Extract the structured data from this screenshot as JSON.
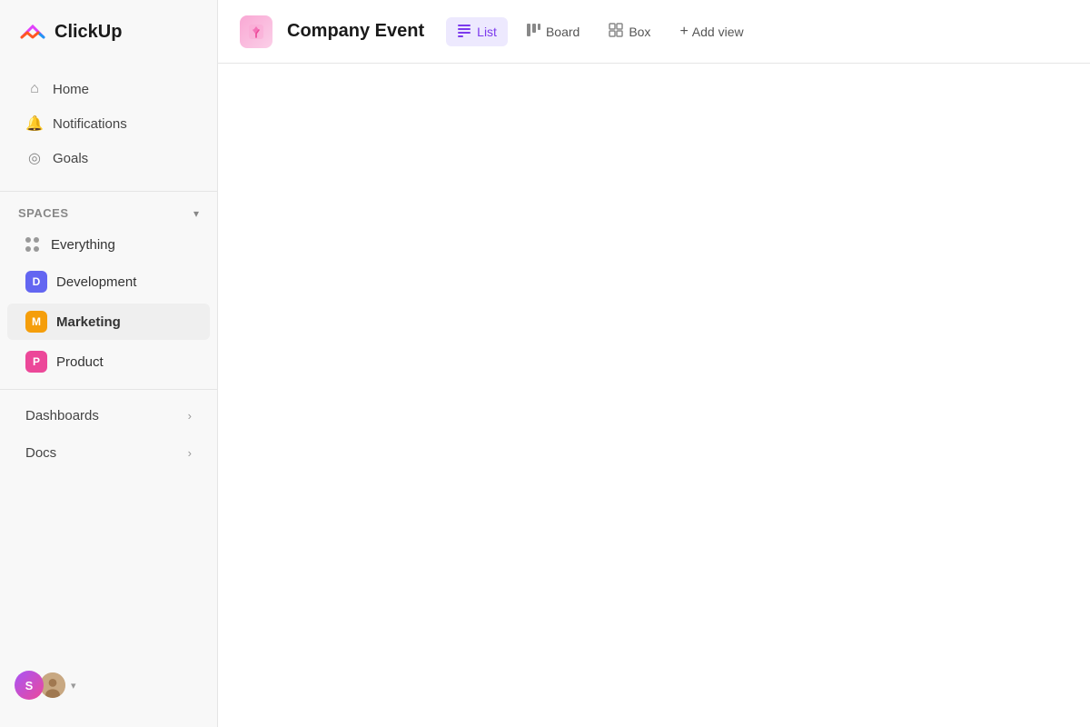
{
  "app": {
    "name": "ClickUp"
  },
  "sidebar": {
    "nav_items": [
      {
        "id": "home",
        "label": "Home",
        "icon": "home"
      },
      {
        "id": "notifications",
        "label": "Notifications",
        "icon": "bell"
      },
      {
        "id": "goals",
        "label": "Goals",
        "icon": "target"
      }
    ],
    "spaces_label": "Spaces",
    "spaces": [
      {
        "id": "everything",
        "label": "Everything",
        "type": "dots"
      },
      {
        "id": "development",
        "label": "Development",
        "type": "avatar",
        "initial": "D",
        "color": "#6366f1"
      },
      {
        "id": "marketing",
        "label": "Marketing",
        "type": "avatar",
        "initial": "M",
        "color": "#f59e0b",
        "bold": true
      },
      {
        "id": "product",
        "label": "Product",
        "type": "avatar",
        "initial": "P",
        "color": "#ec4899"
      }
    ],
    "expandables": [
      {
        "id": "dashboards",
        "label": "Dashboards"
      },
      {
        "id": "docs",
        "label": "Docs"
      }
    ],
    "user_initial": "S"
  },
  "topbar": {
    "project_title": "Company Event",
    "views": [
      {
        "id": "list",
        "label": "List",
        "active": true
      },
      {
        "id": "board",
        "label": "Board",
        "active": false
      },
      {
        "id": "box",
        "label": "Box",
        "active": false
      }
    ],
    "add_view_label": "Add view"
  }
}
